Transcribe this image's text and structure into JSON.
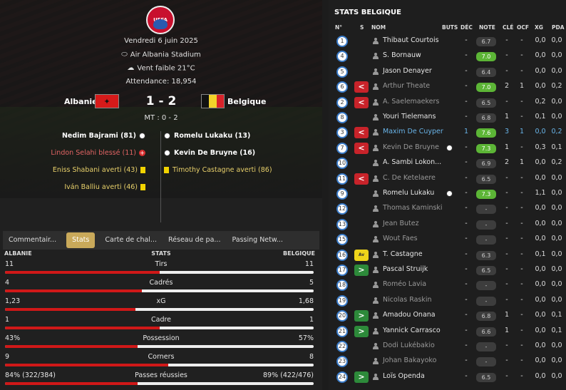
{
  "match": {
    "competition_logo": "UEFA",
    "date": "Vendredi 6 juin 2025",
    "stadium": "Air Albania Stadium",
    "weather": "Vent faible 21°C",
    "attendance": "Attendance: 18,954",
    "home": "Albanie",
    "away": "Belgique",
    "score": "1 - 2",
    "halftime": "MT : 0 - 2",
    "colors": {
      "home_flag": "#d61a1a",
      "away_flag": [
        "#111111",
        "#f3d32a",
        "#d8232a"
      ]
    }
  },
  "events": {
    "home": [
      {
        "text": "Nedim Bajrami (81)",
        "type": "goal"
      },
      {
        "text": "Lindon Selahi blessé (11)",
        "type": "injury"
      },
      {
        "text": "Eniss Shabani averti (43)",
        "type": "yellow"
      },
      {
        "text": "Iván Balliu averti (46)",
        "type": "yellow"
      }
    ],
    "away": [
      {
        "text": "Romelu Lukaku (13)",
        "type": "goal"
      },
      {
        "text": "Kevin De Bruyne (16)",
        "type": "goal"
      },
      {
        "text": "Timothy Castagne averti (86)",
        "type": "yellow"
      }
    ]
  },
  "tabs": [
    "Commentair...",
    "Stats",
    "Carte de chal...",
    "Réseau de pa...",
    "Passing Netw..."
  ],
  "stats_header": {
    "home": "ALBANIE",
    "mid": "STATS",
    "away": "BELGIQUE"
  },
  "stats": [
    {
      "name": "Tirs",
      "home": "11",
      "away": "11",
      "share": 0.5
    },
    {
      "name": "Cadrés",
      "home": "4",
      "away": "5",
      "share": 0.444
    },
    {
      "name": "xG",
      "home": "1,23",
      "away": "1,68",
      "share": 0.423
    },
    {
      "name": "Cadre",
      "home": "1",
      "away": "1",
      "share": 0.5
    },
    {
      "name": "Possession",
      "home": "43%",
      "away": "57%",
      "share": 0.43
    },
    {
      "name": "Corners",
      "home": "9",
      "away": "8",
      "share": 0.529
    },
    {
      "name": "Passes réussies",
      "home": "84% (322/384)",
      "away": "89% (422/476)",
      "share": 0.43
    }
  ],
  "right": {
    "title": "STATS BELGIQUE",
    "columns": [
      "N°",
      "S",
      "NOM",
      "BUTS",
      "DÉC",
      "NOTE",
      "CLÉ",
      "OCF",
      "XG",
      "PDA"
    ],
    "players": [
      {
        "n": "1",
        "sub": "",
        "name": "Thibaut Courtois",
        "buts": "",
        "dec": "-",
        "note": "6.7",
        "nc": "d",
        "cle": "-",
        "ocf": "-",
        "xg": "0,0",
        "pda": "0,0",
        "st": ""
      },
      {
        "n": "4",
        "sub": "",
        "name": "S. Bornauw",
        "buts": "",
        "dec": "-",
        "note": "7.0",
        "nc": "g",
        "cle": "-",
        "ocf": "-",
        "xg": "0,0",
        "pda": "0,0",
        "st": ""
      },
      {
        "n": "5",
        "sub": "",
        "name": "Jason Denayer",
        "buts": "",
        "dec": "-",
        "note": "6.4",
        "nc": "d",
        "cle": "-",
        "ocf": "-",
        "xg": "0,0",
        "pda": "0,0",
        "st": ""
      },
      {
        "n": "6",
        "sub": "out",
        "name": "Arthur Theate",
        "buts": "",
        "dec": "-",
        "note": "7.0",
        "nc": "g",
        "cle": "2",
        "ocf": "1",
        "xg": "0,0",
        "pda": "0,2",
        "st": "dim"
      },
      {
        "n": "2",
        "sub": "out",
        "name": "A. Saelemaekers",
        "buts": "",
        "dec": "-",
        "note": "6.5",
        "nc": "d",
        "cle": "-",
        "ocf": "-",
        "xg": "0,2",
        "pda": "0,0",
        "st": "dim"
      },
      {
        "n": "8",
        "sub": "",
        "name": "Youri Tielemans",
        "buts": "",
        "dec": "-",
        "note": "6.8",
        "nc": "d",
        "cle": "1",
        "ocf": "-",
        "xg": "0,1",
        "pda": "0,0",
        "st": ""
      },
      {
        "n": "3",
        "sub": "out",
        "name": "Maxim De Cuyper",
        "buts": "",
        "dec": "1",
        "note": "7.6",
        "nc": "g",
        "cle": "3",
        "ocf": "1",
        "xg": "0,0",
        "pda": "0,2",
        "st": "hl"
      },
      {
        "n": "7",
        "sub": "out",
        "name": "Kevin De Bruyne",
        "buts": "goal",
        "dec": "-",
        "note": "7.3",
        "nc": "g",
        "cle": "1",
        "ocf": "-",
        "xg": "0,3",
        "pda": "0,1",
        "st": "dim"
      },
      {
        "n": "10",
        "sub": "",
        "name": "A. Sambi Lokon...",
        "buts": "",
        "dec": "-",
        "note": "6.9",
        "nc": "d",
        "cle": "2",
        "ocf": "1",
        "xg": "0,0",
        "pda": "0,2",
        "st": ""
      },
      {
        "n": "11",
        "sub": "out",
        "name": "C. De Ketelaere",
        "buts": "",
        "dec": "-",
        "note": "6.5",
        "nc": "d",
        "cle": "-",
        "ocf": "-",
        "xg": "0,0",
        "pda": "0,0",
        "st": "dim"
      },
      {
        "n": "9",
        "sub": "",
        "name": "Romelu Lukaku",
        "buts": "goal",
        "dec": "-",
        "note": "7.3",
        "nc": "g",
        "cle": "-",
        "ocf": "-",
        "xg": "1,1",
        "pda": "0,0",
        "st": ""
      },
      {
        "n": "12",
        "sub": "",
        "name": "Thomas Kaminski",
        "buts": "",
        "dec": "-",
        "note": "-",
        "nc": "d",
        "cle": "-",
        "ocf": "-",
        "xg": "0,0",
        "pda": "0,0",
        "st": "dim"
      },
      {
        "n": "13",
        "sub": "",
        "name": "Jean Butez",
        "buts": "",
        "dec": "-",
        "note": "-",
        "nc": "d",
        "cle": "-",
        "ocf": "-",
        "xg": "0,0",
        "pda": "0,0",
        "st": "dim"
      },
      {
        "n": "15",
        "sub": "",
        "name": "Wout Faes",
        "buts": "",
        "dec": "-",
        "note": "-",
        "nc": "d",
        "cle": "-",
        "ocf": "-",
        "xg": "0,0",
        "pda": "0,0",
        "st": "dim"
      },
      {
        "n": "16",
        "sub": "av",
        "name": "T. Castagne",
        "buts": "",
        "dec": "-",
        "note": "6.3",
        "nc": "d",
        "cle": "-",
        "ocf": "-",
        "xg": "0,1",
        "pda": "0,0",
        "st": ""
      },
      {
        "n": "17",
        "sub": "in",
        "name": "Pascal Struijk",
        "buts": "",
        "dec": "-",
        "note": "6.5",
        "nc": "d",
        "cle": "-",
        "ocf": "-",
        "xg": "0,0",
        "pda": "0,0",
        "st": ""
      },
      {
        "n": "18",
        "sub": "",
        "name": "Roméo Lavia",
        "buts": "",
        "dec": "-",
        "note": "-",
        "nc": "d",
        "cle": "-",
        "ocf": "-",
        "xg": "0,0",
        "pda": "0,0",
        "st": "dim"
      },
      {
        "n": "19",
        "sub": "",
        "name": "Nicolas Raskin",
        "buts": "",
        "dec": "-",
        "note": "-",
        "nc": "d",
        "cle": "-",
        "ocf": "-",
        "xg": "0,0",
        "pda": "0,0",
        "st": "dim"
      },
      {
        "n": "20",
        "sub": "in",
        "name": "Amadou Onana",
        "buts": "",
        "dec": "-",
        "note": "6.8",
        "nc": "d",
        "cle": "1",
        "ocf": "-",
        "xg": "0,0",
        "pda": "0,1",
        "st": ""
      },
      {
        "n": "21",
        "sub": "in",
        "name": "Yannick Carrasco",
        "buts": "",
        "dec": "-",
        "note": "6.6",
        "nc": "d",
        "cle": "1",
        "ocf": "-",
        "xg": "0,0",
        "pda": "0,1",
        "st": ""
      },
      {
        "n": "22",
        "sub": "",
        "name": "Dodi Lukébakio",
        "buts": "",
        "dec": "-",
        "note": "-",
        "nc": "d",
        "cle": "-",
        "ocf": "-",
        "xg": "0,0",
        "pda": "0,0",
        "st": "dim"
      },
      {
        "n": "23",
        "sub": "",
        "name": "Johan Bakayoko",
        "buts": "",
        "dec": "-",
        "note": "-",
        "nc": "d",
        "cle": "-",
        "ocf": "-",
        "xg": "0,0",
        "pda": "0,0",
        "st": "dim"
      },
      {
        "n": "24",
        "sub": "in",
        "name": "Loïs Openda",
        "buts": "",
        "dec": "-",
        "note": "6.5",
        "nc": "d",
        "cle": "-",
        "ocf": "-",
        "xg": "0,0",
        "pda": "0,0",
        "st": ""
      }
    ],
    "sub_labels": {
      "out": "<",
      "in": ">",
      "av": "Av"
    }
  }
}
